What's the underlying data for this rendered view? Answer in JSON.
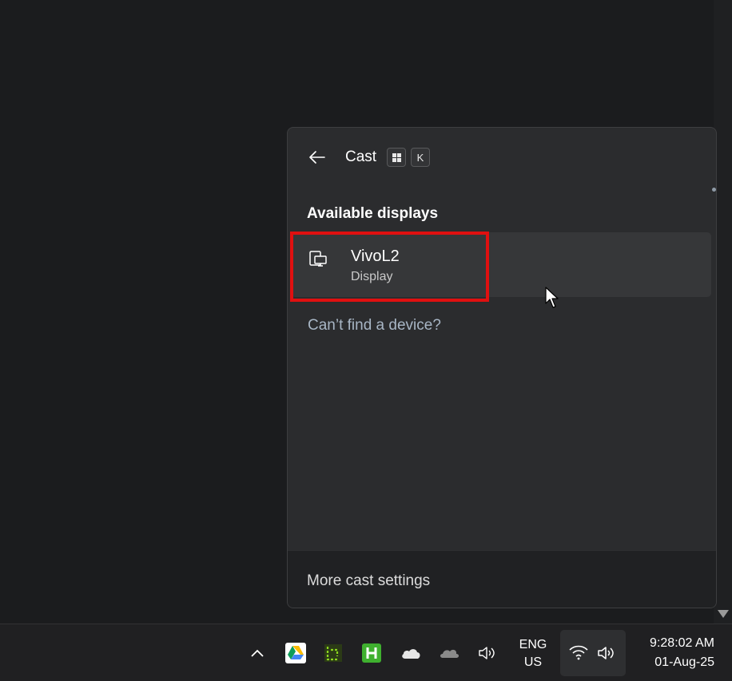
{
  "cast_panel": {
    "title": "Cast",
    "shortcut_keys": [
      "win-key",
      "K"
    ],
    "section_title": "Available displays",
    "devices": [
      {
        "name": "VivoL2",
        "type": "Display",
        "icon": "display-cast-icon"
      }
    ],
    "cant_find_link": "Can’t find a device?",
    "more_settings_link": "More cast settings"
  },
  "taskbar": {
    "tray_icons": [
      "chevron-up-icon",
      "google-drive-icon",
      "greenshot-icon",
      "hyper-h-icon",
      "onedrive-icon",
      "cloud-icon",
      "speaker-icon"
    ],
    "language": {
      "line1": "ENG",
      "line2": "US"
    },
    "clock": {
      "time": "9:28:02 AM",
      "date": "01-Aug-25"
    }
  },
  "colors": {
    "highlight_border": "#e01010",
    "panel_background": "#2b2c2e",
    "link_color": "#a8b6c5",
    "desktop": "#1b1c1e"
  }
}
